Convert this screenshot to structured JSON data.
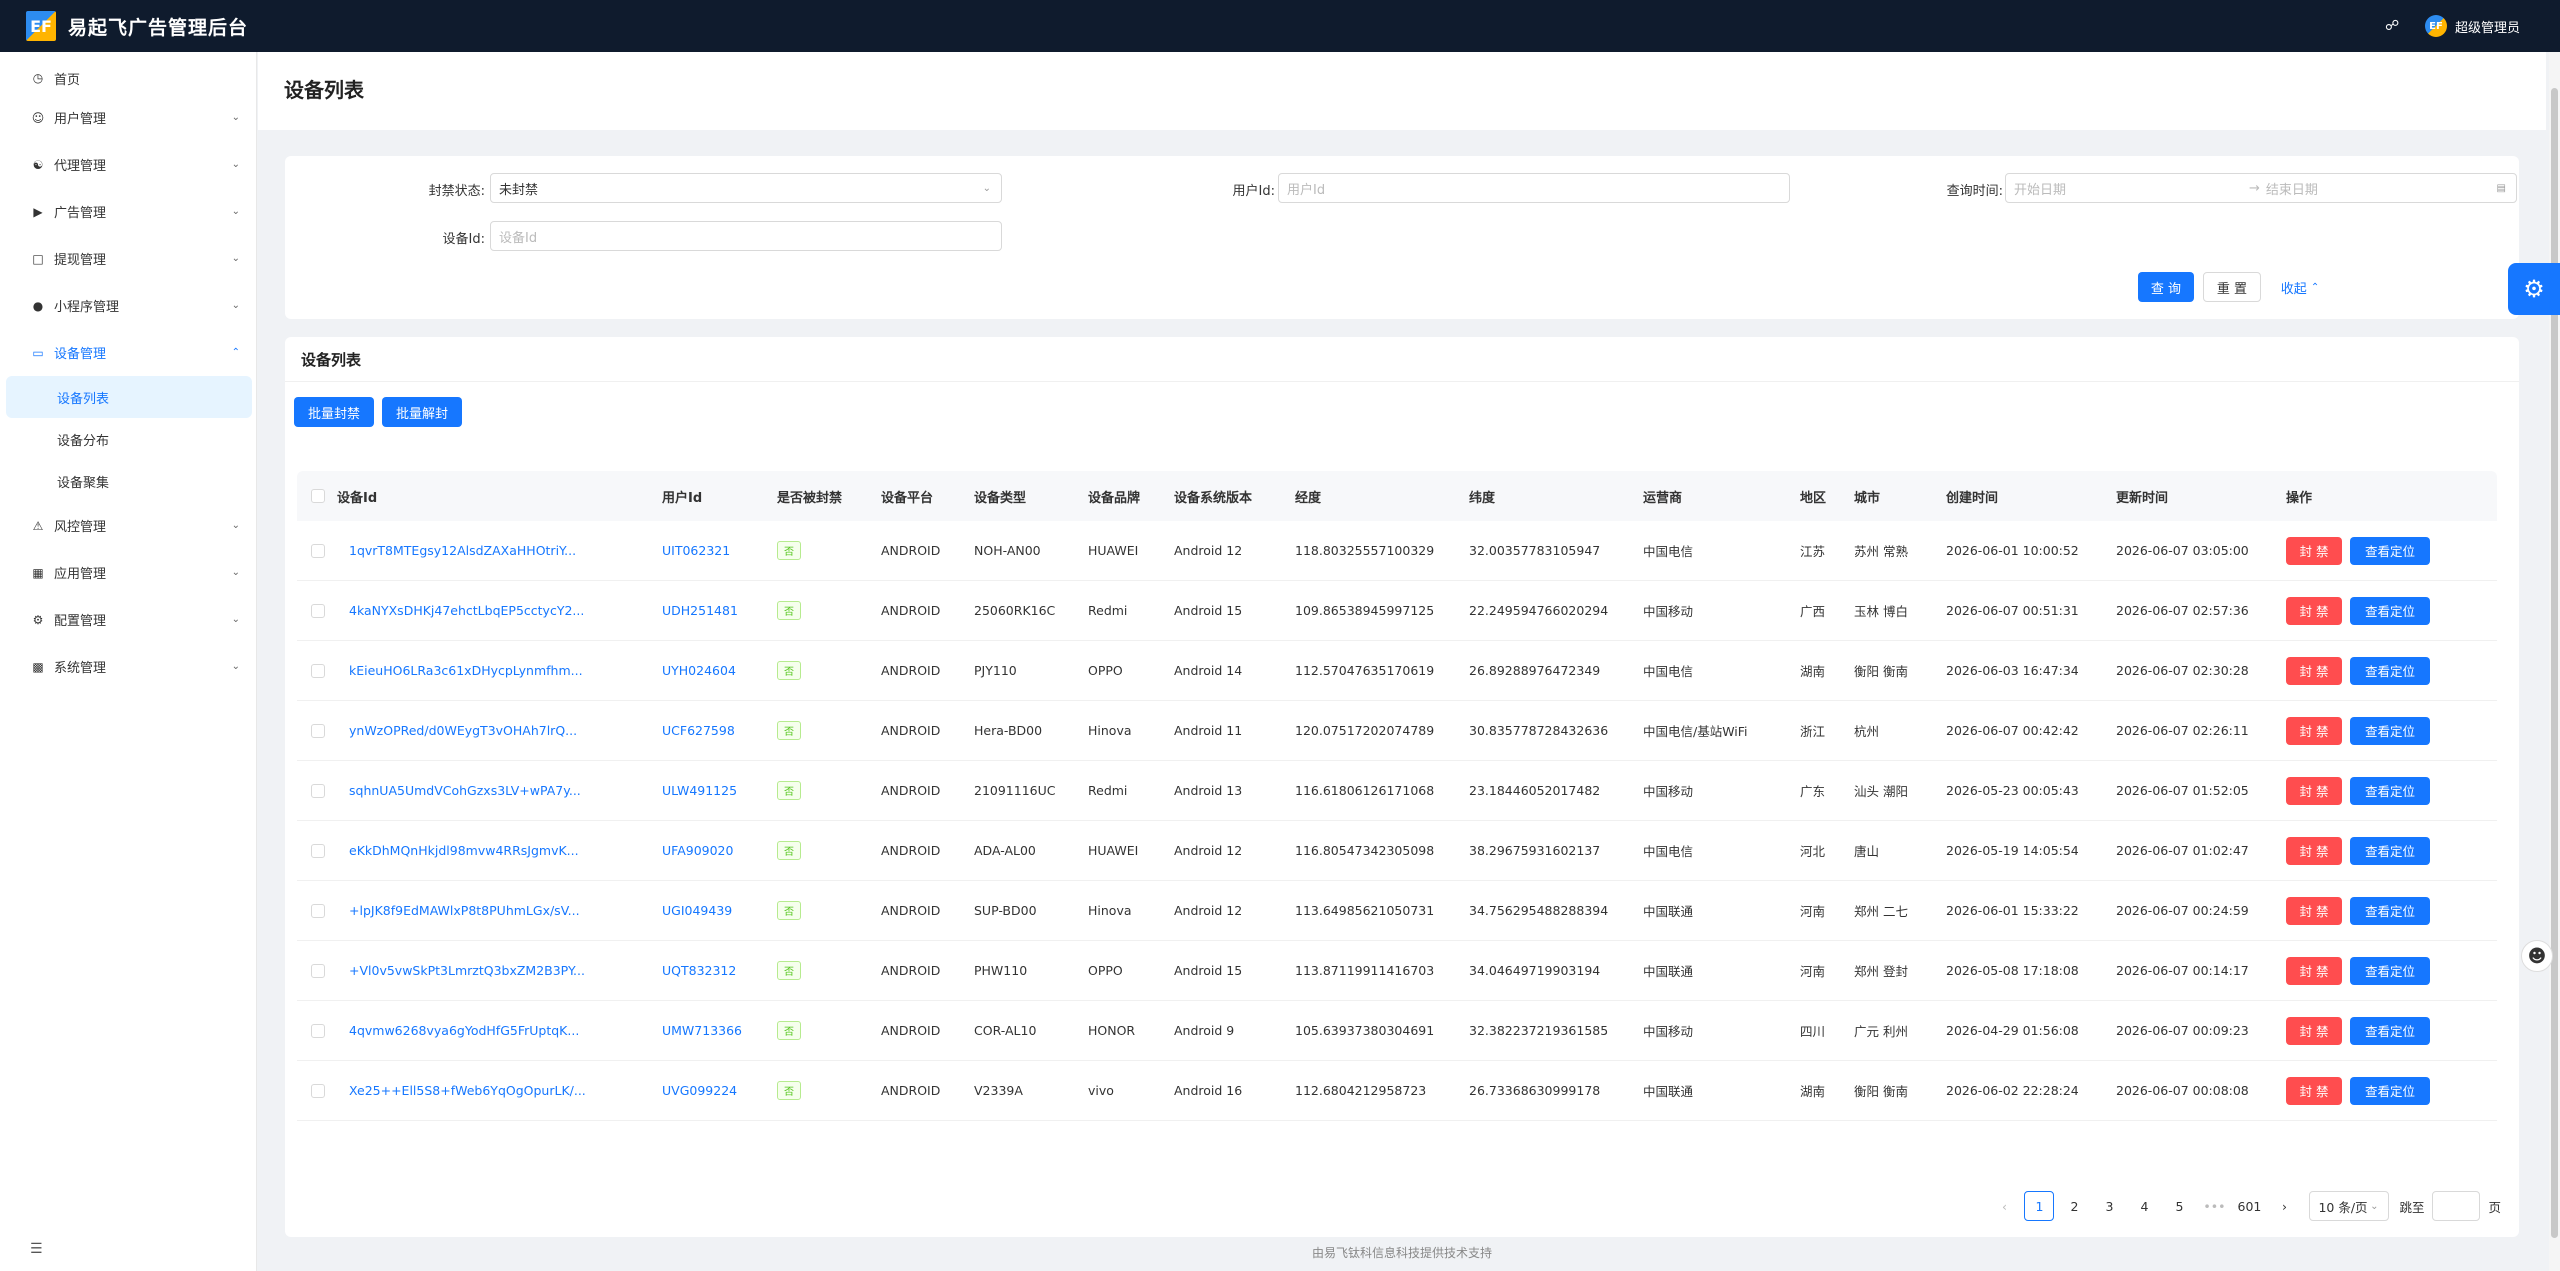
{
  "app": {
    "title": "易起飞广告管理后台",
    "logo_text": "EF"
  },
  "header": {
    "user_name": "超级管理员",
    "avatar_text": "EF"
  },
  "sidebar": {
    "items": [
      {
        "label": "首页",
        "icon": "home-icon"
      },
      {
        "label": "用户管理",
        "icon": "user-icon"
      },
      {
        "label": "代理管理",
        "icon": "agent-icon"
      },
      {
        "label": "广告管理",
        "icon": "ad-icon"
      },
      {
        "label": "提现管理",
        "icon": "withdraw-icon"
      },
      {
        "label": "小程序管理",
        "icon": "wechat-icon"
      },
      {
        "label": "设备管理",
        "icon": "device-icon"
      },
      {
        "label": "风控管理",
        "icon": "warning-icon"
      },
      {
        "label": "应用管理",
        "icon": "apps-icon"
      },
      {
        "label": "配置管理",
        "icon": "settings-icon"
      },
      {
        "label": "系统管理",
        "icon": "system-icon"
      }
    ],
    "device_sub": [
      "设备列表",
      "设备分布",
      "设备聚集"
    ]
  },
  "page": {
    "title": "设备列表"
  },
  "search": {
    "ban_status_label": "封禁状态:",
    "ban_status_value": "未封禁",
    "user_id_label": "用户Id:",
    "user_id_placeholder": "用户Id",
    "query_time_label": "查询时间:",
    "start_date_placeholder": "开始日期",
    "end_date_placeholder": "结束日期",
    "device_id_label": "设备Id:",
    "device_id_placeholder": "设备Id",
    "query_button": "查 询",
    "reset_button": "重 置",
    "collapse_link": "收起"
  },
  "table_card": {
    "title": "设备列表",
    "batch_ban": "批量封禁",
    "batch_unban": "批量解封",
    "columns": [
      "设备Id",
      "用户Id",
      "是否被封禁",
      "设备平台",
      "设备类型",
      "设备品牌",
      "设备系统版本",
      "经度",
      "纬度",
      "运营商",
      "地区",
      "城市",
      "创建时间",
      "更新时间",
      "操作"
    ],
    "ban_action": "封 禁",
    "locate_action": "查看定位",
    "rows": [
      {
        "device_id": "1qvrT8MTEgsy12AlsdZAXaHHOtriY...",
        "user_id": "UIT062321",
        "banned": "否",
        "platform": "ANDROID",
        "type": "NOH-AN00",
        "brand": "HUAWEI",
        "os": "Android 12",
        "lon": "118.80325557100329",
        "lat": "32.00357783105947",
        "carrier": "中国电信",
        "region": "江苏",
        "city": "苏州 常熟",
        "created": "2026-06-01 10:00:52",
        "updated": "2026-06-07 03:05:00"
      },
      {
        "device_id": "4kaNYXsDHKj47ehctLbqEP5cctycY2...",
        "user_id": "UDH251481",
        "banned": "否",
        "platform": "ANDROID",
        "type": "25060RK16C",
        "brand": "Redmi",
        "os": "Android 15",
        "lon": "109.86538945997125",
        "lat": "22.249594766020294",
        "carrier": "中国移动",
        "region": "广西",
        "city": "玉林 博白",
        "created": "2026-06-07 00:51:31",
        "updated": "2026-06-07 02:57:36"
      },
      {
        "device_id": "kEieuHO6LRa3c61xDHycpLynmfhm...",
        "user_id": "UYH024604",
        "banned": "否",
        "platform": "ANDROID",
        "type": "PJY110",
        "brand": "OPPO",
        "os": "Android 14",
        "lon": "112.57047635170619",
        "lat": "26.89288976472349",
        "carrier": "中国电信",
        "region": "湖南",
        "city": "衡阳 衡南",
        "created": "2026-06-03 16:47:34",
        "updated": "2026-06-07 02:30:28"
      },
      {
        "device_id": "ynWzOPRed/d0WEygT3vOHAh7lrQ...",
        "user_id": "UCF627598",
        "banned": "否",
        "platform": "ANDROID",
        "type": "Hera-BD00",
        "brand": "Hinova",
        "os": "Android 11",
        "lon": "120.07517202074789",
        "lat": "30.835778728432636",
        "carrier": "中国电信/基站WiFi",
        "region": "浙江",
        "city": "杭州",
        "created": "2026-06-07 00:42:42",
        "updated": "2026-06-07 02:26:11"
      },
      {
        "device_id": "sqhnUA5UmdVCohGzxs3LV+wPA7y...",
        "user_id": "ULW491125",
        "banned": "否",
        "platform": "ANDROID",
        "type": "21091116UC",
        "brand": "Redmi",
        "os": "Android 13",
        "lon": "116.61806126171068",
        "lat": "23.18446052017482",
        "carrier": "中国移动",
        "region": "广东",
        "city": "汕头 潮阳",
        "created": "2026-05-23 00:05:43",
        "updated": "2026-06-07 01:52:05"
      },
      {
        "device_id": "eKkDhMQnHkjdl98mvw4RRsJgmvK...",
        "user_id": "UFA909020",
        "banned": "否",
        "platform": "ANDROID",
        "type": "ADA-AL00",
        "brand": "HUAWEI",
        "os": "Android 12",
        "lon": "116.80547342305098",
        "lat": "38.29675931602137",
        "carrier": "中国电信",
        "region": "河北",
        "city": "唐山",
        "created": "2026-05-19 14:05:54",
        "updated": "2026-06-07 01:02:47"
      },
      {
        "device_id": "+lpJK8f9EdMAWlxP8t8PUhmLGx/sV...",
        "user_id": "UGI049439",
        "banned": "否",
        "platform": "ANDROID",
        "type": "SUP-BD00",
        "brand": "Hinova",
        "os": "Android 12",
        "lon": "113.64985621050731",
        "lat": "34.756295488288394",
        "carrier": "中国联通",
        "region": "河南",
        "city": "郑州 二七",
        "created": "2026-06-01 15:33:22",
        "updated": "2026-06-07 00:24:59"
      },
      {
        "device_id": "+Vl0v5vwSkPt3LmrztQ3bxZM2B3PY...",
        "user_id": "UQT832312",
        "banned": "否",
        "platform": "ANDROID",
        "type": "PHW110",
        "brand": "OPPO",
        "os": "Android 15",
        "lon": "113.87119911416703",
        "lat": "34.04649719903194",
        "carrier": "中国联通",
        "region": "河南",
        "city": "郑州 登封",
        "created": "2026-05-08 17:18:08",
        "updated": "2026-06-07 00:14:17"
      },
      {
        "device_id": "4qvmw6268vya6gYodHfG5FrUptqK...",
        "user_id": "UMW713366",
        "banned": "否",
        "platform": "ANDROID",
        "type": "COR-AL10",
        "brand": "HONOR",
        "os": "Android 9",
        "lon": "105.63937380304691",
        "lat": "32.382237219361585",
        "carrier": "中国移动",
        "region": "四川",
        "city": "广元 利州",
        "created": "2026-04-29 01:56:08",
        "updated": "2026-06-07 00:09:23"
      },
      {
        "device_id": "Xe25++Ell5S8+fWeb6YqOgOpurLK/...",
        "user_id": "UVG099224",
        "banned": "否",
        "platform": "ANDROID",
        "type": "V2339A",
        "brand": "vivo",
        "os": "Android 16",
        "lon": "112.6804212958723",
        "lat": "26.73368630999178",
        "carrier": "中国联通",
        "region": "湖南",
        "city": "衡阳 衡南",
        "created": "2026-06-02 22:28:24",
        "updated": "2026-06-07 00:08:08"
      }
    ]
  },
  "pagination": {
    "pages": [
      "1",
      "2",
      "3",
      "4",
      "5"
    ],
    "ellipsis": "•••",
    "last_page": "601",
    "page_size": "10 条/页",
    "jump_label": "跳至",
    "page_unit": "页",
    "current_page": "1"
  },
  "footer": {
    "text": "由易飞钛科信息科技提供技术支持"
  }
}
